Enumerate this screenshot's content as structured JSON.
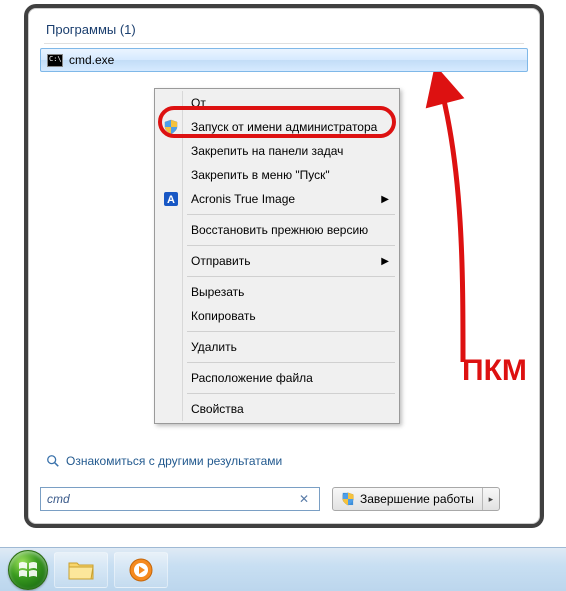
{
  "section": {
    "header": "Программы (1)",
    "result_label": "cmd.exe"
  },
  "context_menu": {
    "open_truncated": "От",
    "run_as_admin": "Запуск от имени администратора",
    "pin_taskbar": "Закрепить на панели задач",
    "pin_start": "Закрепить в меню \"Пуск\"",
    "acronis": "Acronis True Image",
    "restore_prev": "Восстановить прежнюю версию",
    "send_to": "Отправить",
    "cut": "Вырезать",
    "copy": "Копировать",
    "delete": "Удалить",
    "file_location": "Расположение файла",
    "properties": "Свойства"
  },
  "annotation": {
    "pkm": "ПКМ"
  },
  "footer": {
    "see_more": "Ознакомиться с другими результатами",
    "search_value": "cmd",
    "shutdown": "Завершение работы"
  },
  "icons": {
    "shield": "shield-icon",
    "acronis": "acronis-icon",
    "magnifier": "magnifier-icon",
    "clear": "clear-icon",
    "chevron": "chevron-right-icon",
    "dropdown": "chevron-right-small",
    "start": "start-orb",
    "explorer": "explorer-icon",
    "media": "media-player-icon"
  }
}
